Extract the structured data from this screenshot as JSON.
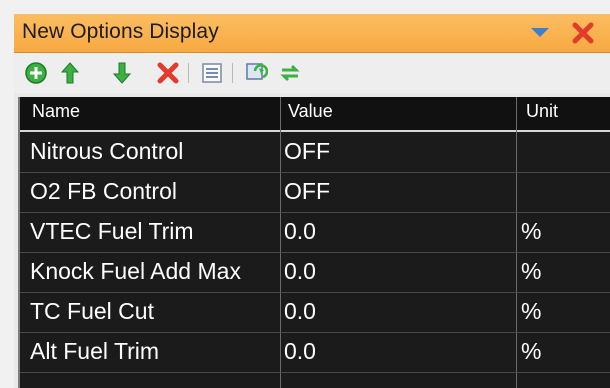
{
  "window": {
    "title": "New Options Display"
  },
  "toolbar": {
    "icons": [
      "add-icon",
      "move-up-icon",
      "move-down-icon",
      "delete-icon",
      "list-icon",
      "refresh-icon",
      "sync-icon"
    ]
  },
  "table": {
    "headers": {
      "name": "Name",
      "value": "Value",
      "unit": "Unit"
    },
    "rows": [
      {
        "name": "Nitrous Control",
        "value": "OFF",
        "unit": ""
      },
      {
        "name": "O2 FB Control",
        "value": "OFF",
        "unit": ""
      },
      {
        "name": "VTEC Fuel Trim",
        "value": "0.0",
        "unit": "%"
      },
      {
        "name": "Knock Fuel Add Max",
        "value": "0.0",
        "unit": "%"
      },
      {
        "name": "TC Fuel Cut",
        "value": "0.0",
        "unit": "%"
      },
      {
        "name": "Alt Fuel Trim",
        "value": "0.0",
        "unit": "%"
      }
    ]
  },
  "colors": {
    "titlebar": "#f7a941",
    "grid_bg": "#1b1b1b",
    "close_red": "#e23b2c",
    "add_green": "#3cb043"
  }
}
